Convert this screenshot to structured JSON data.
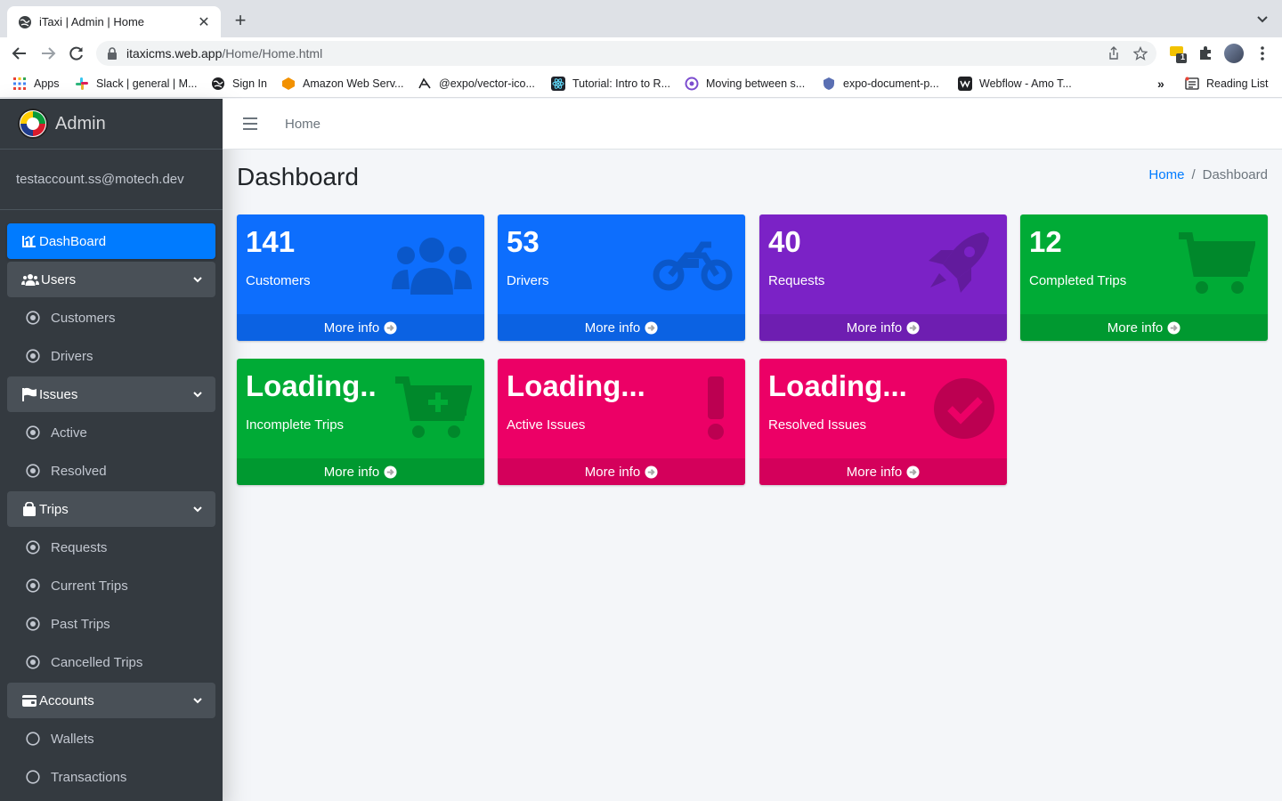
{
  "browser": {
    "tab_title": "iTaxi | Admin | Home",
    "url_host": "itaxicms.web.app",
    "url_path": "/Home/Home.html",
    "extension_badge": "1",
    "bookmarks": [
      {
        "label": "Apps",
        "icon": "apps-grid-icon"
      },
      {
        "label": "Slack | general | M...",
        "icon": "slack-icon"
      },
      {
        "label": "Sign In",
        "icon": "globe-icon"
      },
      {
        "label": "Amazon Web Serv...",
        "icon": "aws-icon"
      },
      {
        "label": "@expo/vector-ico...",
        "icon": "github-icon"
      },
      {
        "label": "Tutorial: Intro to R...",
        "icon": "react-icon"
      },
      {
        "label": "Moving between s...",
        "icon": "circle-icon"
      },
      {
        "label": "expo-document-p...",
        "icon": "shield-icon"
      },
      {
        "label": "Webflow - Amo T...",
        "icon": "webflow-icon"
      }
    ],
    "more_bookmarks": "»",
    "reading_list": "Reading List"
  },
  "sidebar": {
    "brand": "Admin",
    "user_email": "testaccount.ss@motech.dev",
    "items": [
      {
        "label": "DashBoard",
        "kind": "active"
      },
      {
        "label": "Users",
        "kind": "header"
      },
      {
        "label": "Customers",
        "kind": "sub"
      },
      {
        "label": "Drivers",
        "kind": "sub"
      },
      {
        "label": "Issues",
        "kind": "header"
      },
      {
        "label": "Active",
        "kind": "sub"
      },
      {
        "label": "Resolved",
        "kind": "sub"
      },
      {
        "label": "Trips",
        "kind": "header"
      },
      {
        "label": "Requests",
        "kind": "sub"
      },
      {
        "label": "Current Trips",
        "kind": "sub"
      },
      {
        "label": "Past Trips",
        "kind": "sub"
      },
      {
        "label": "Cancelled Trips",
        "kind": "sub"
      },
      {
        "label": "Accounts",
        "kind": "header"
      },
      {
        "label": "Wallets",
        "kind": "sub"
      },
      {
        "label": "Transactions",
        "kind": "sub"
      }
    ]
  },
  "topnav": {
    "home_link": "Home"
  },
  "page": {
    "title": "Dashboard",
    "breadcrumb": {
      "home": "Home",
      "separator": "/",
      "current": "Dashboard"
    }
  },
  "cards": [
    {
      "value": "141",
      "label": "Customers",
      "footer": "More info",
      "color": "#0d6efd",
      "icon": "users-icon"
    },
    {
      "value": "53",
      "label": "Drivers",
      "footer": "More info",
      "color": "#0d6efd",
      "icon": "motorcycle-icon"
    },
    {
      "value": "40",
      "label": "Requests",
      "footer": "More info",
      "color": "#7b22c6",
      "icon": "rocket-icon"
    },
    {
      "value": "12",
      "label": "Completed Trips",
      "footer": "More info",
      "color": "#00ab36",
      "icon": "cart-icon"
    },
    {
      "value": "Loading..",
      "label": "Incomplete Trips",
      "footer": "More info",
      "color": "#00ab36",
      "icon": "cart-plus-icon"
    },
    {
      "value": "Loading...",
      "label": "Active Issues",
      "footer": "More info",
      "color": "#ec0066",
      "icon": "exclamation-icon"
    },
    {
      "value": "Loading...",
      "label": "Resolved Issues",
      "footer": "More info",
      "color": "#ec0066",
      "icon": "check-circle-icon"
    }
  ]
}
